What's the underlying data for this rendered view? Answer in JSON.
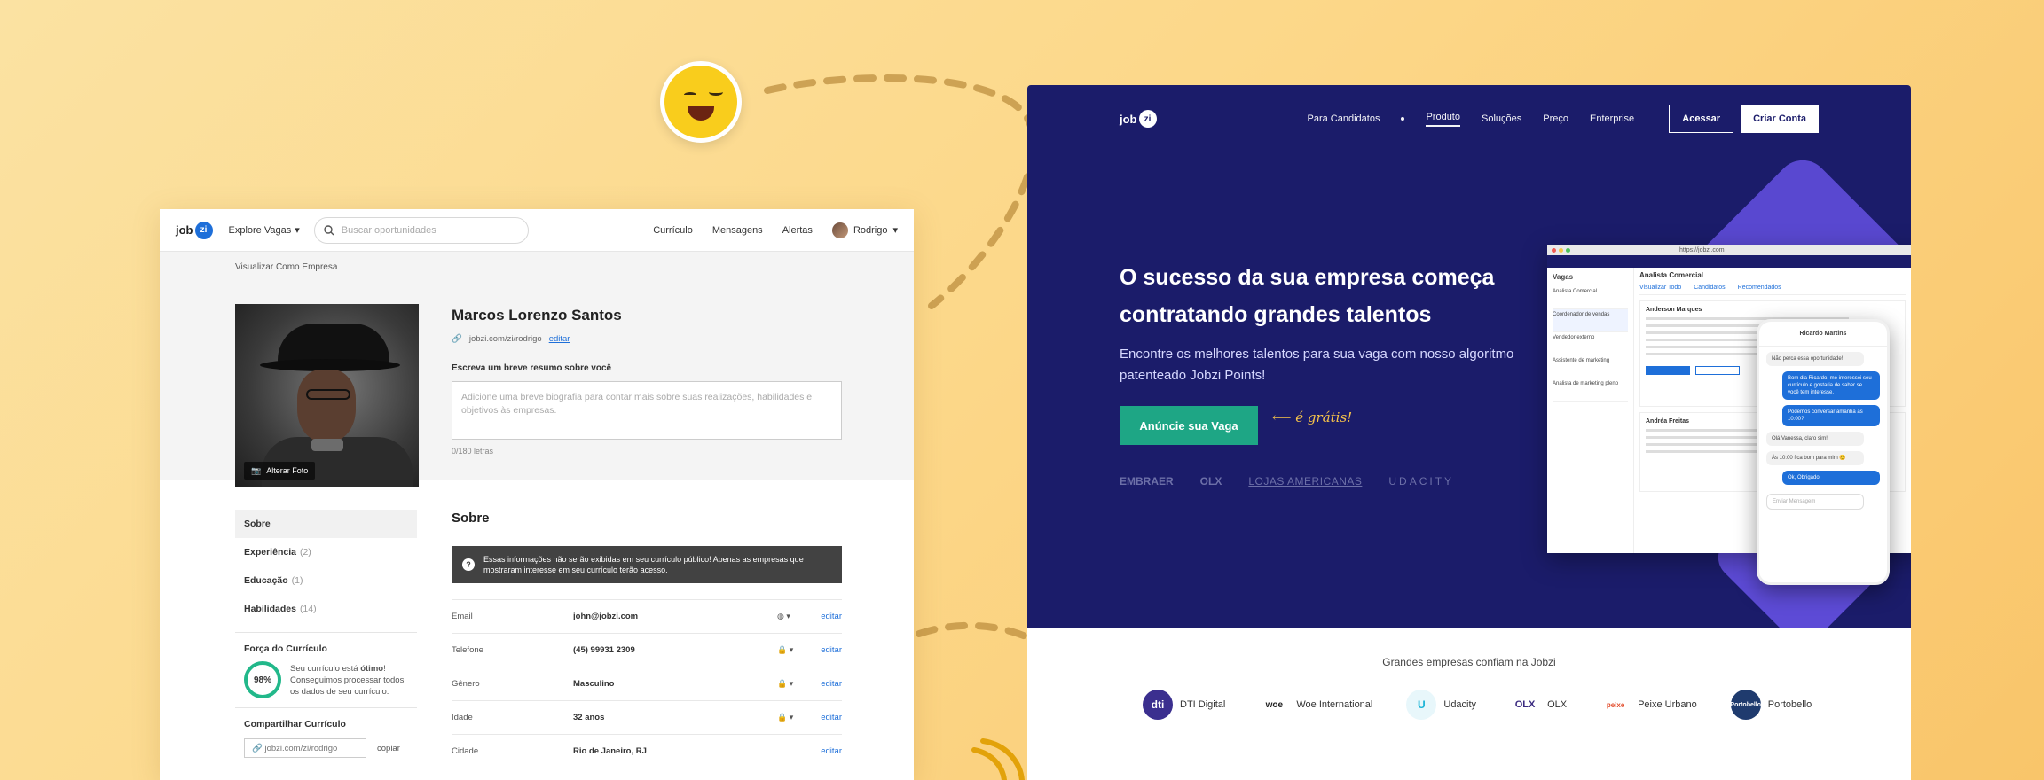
{
  "left": {
    "nav": {
      "logo_text": "job",
      "logo_badge": "zi",
      "explore": "Explore Vagas",
      "search_placeholder": "Buscar oportunidades",
      "links": [
        "Currículo",
        "Mensagens",
        "Alertas"
      ],
      "user": "Rodrigo"
    },
    "view_as_company": "Visualizar Como Empresa",
    "change_photo": "Alterar Foto",
    "name": "Marcos Lorenzo Santos",
    "profile_url": "jobzi.com/zi/rodrigo",
    "edit_link": "editar",
    "bio_label": "Escreva um breve resumo sobre você",
    "bio_placeholder": "Adicione uma breve biografia para contar mais sobre suas realizações, habilidades e objetivos às empresas.",
    "char_count": "0/180 letras",
    "sidebar": [
      {
        "label": "Sobre",
        "count": ""
      },
      {
        "label": "Experiência",
        "count": "(2)"
      },
      {
        "label": "Educação",
        "count": "(1)"
      },
      {
        "label": "Habilidades",
        "count": "(14)"
      }
    ],
    "strength_title": "Força do Currículo",
    "strength_percent": "98%",
    "strength_text_a": "Seu currículo está ",
    "strength_text_b": "ótimo",
    "strength_text_c": "! Conseguimos processar todos os dados de seu currículo.",
    "share_title": "Compartilhar Currículo",
    "share_url": "jobzi.com/zi/rodrigo",
    "copy": "copiar",
    "about_title": "Sobre",
    "notice": "Essas informações não serão exibidas em seu currículo público! Apenas as empresas que mostraram interesse em seu currículo terão acesso.",
    "fields": [
      {
        "label": "Email",
        "value": "john@jobzi.com",
        "edit": "editar"
      },
      {
        "label": "Telefone",
        "value": "(45) 99931 2309",
        "edit": "editar"
      },
      {
        "label": "Gênero",
        "value": "Masculino",
        "edit": "editar"
      },
      {
        "label": "Idade",
        "value": "32 anos",
        "edit": "editar"
      },
      {
        "label": "Cidade",
        "value": "Rio de Janeiro, RJ",
        "edit": "editar"
      }
    ]
  },
  "right": {
    "nav": {
      "logo_text": "job",
      "logo_badge": "zi",
      "items": [
        "Para Candidatos",
        "Produto",
        "Soluções",
        "Preço",
        "Enterprise"
      ],
      "login": "Acessar",
      "signup": "Criar Conta"
    },
    "hero_title": "O sucesso da sua empresa começa contratando grandes talentos",
    "hero_subtitle": "Encontre os melhores talentos para sua vaga com nosso algoritmo patenteado Jobzi Points!",
    "cta": "Anúncie sua Vaga",
    "free": "é grátis!",
    "partners": [
      "EMBRAER",
      "OLX",
      "LOJAS AMERICANAS",
      "UDACITY"
    ],
    "browser": {
      "url": "https://jobzi.com",
      "sidebar_title": "Vagas",
      "sidebar_items": [
        "Analista Comercial",
        "Coordenador de vendas",
        "Vendedor externo",
        "Assistente de marketing",
        "Analista de marketing pleno"
      ],
      "main_title": "Analista Comercial",
      "tabs": [
        "Visualizar Todo",
        "Candidatos",
        "Recomendados"
      ],
      "candidates": [
        "Anderson Marques",
        "Andréa Freitas"
      ]
    },
    "phone": {
      "title": "Ricardo Martins",
      "messages": [
        {
          "side": "l",
          "text": "Não perca essa oportunidade!"
        },
        {
          "side": "r",
          "text": "Bom dia Ricardo, me interessei seu currículo e gostaria de saber se você tem interesse."
        },
        {
          "side": "r",
          "text": "Podemos conversar amanhã às 10:00?"
        },
        {
          "side": "l",
          "text": "Olá Vanessa, claro sim!"
        },
        {
          "side": "l",
          "text": "Às 10:00 fica bom para mim 😊"
        },
        {
          "side": "r",
          "text": "Ok, Obrigado!"
        }
      ],
      "input_placeholder": "Enviar Mensagem"
    },
    "trust_title": "Grandes empresas confiam na Jobzi",
    "companies": [
      {
        "name": "DTI Digital",
        "mark": "dti",
        "color": "#3b2f8f"
      },
      {
        "name": "Woe International",
        "mark": "woe",
        "color": "#222222"
      },
      {
        "name": "Udacity",
        "mark": "U",
        "color": "#19b3d6"
      },
      {
        "name": "OLX",
        "mark": "OLX",
        "color": "#f5a623"
      },
      {
        "name": "Peixe Urbano",
        "mark": "peixe",
        "color": "#e24b2a"
      },
      {
        "name": "Portobello",
        "mark": "Portobello",
        "color": "#1f3b6e"
      }
    ]
  }
}
